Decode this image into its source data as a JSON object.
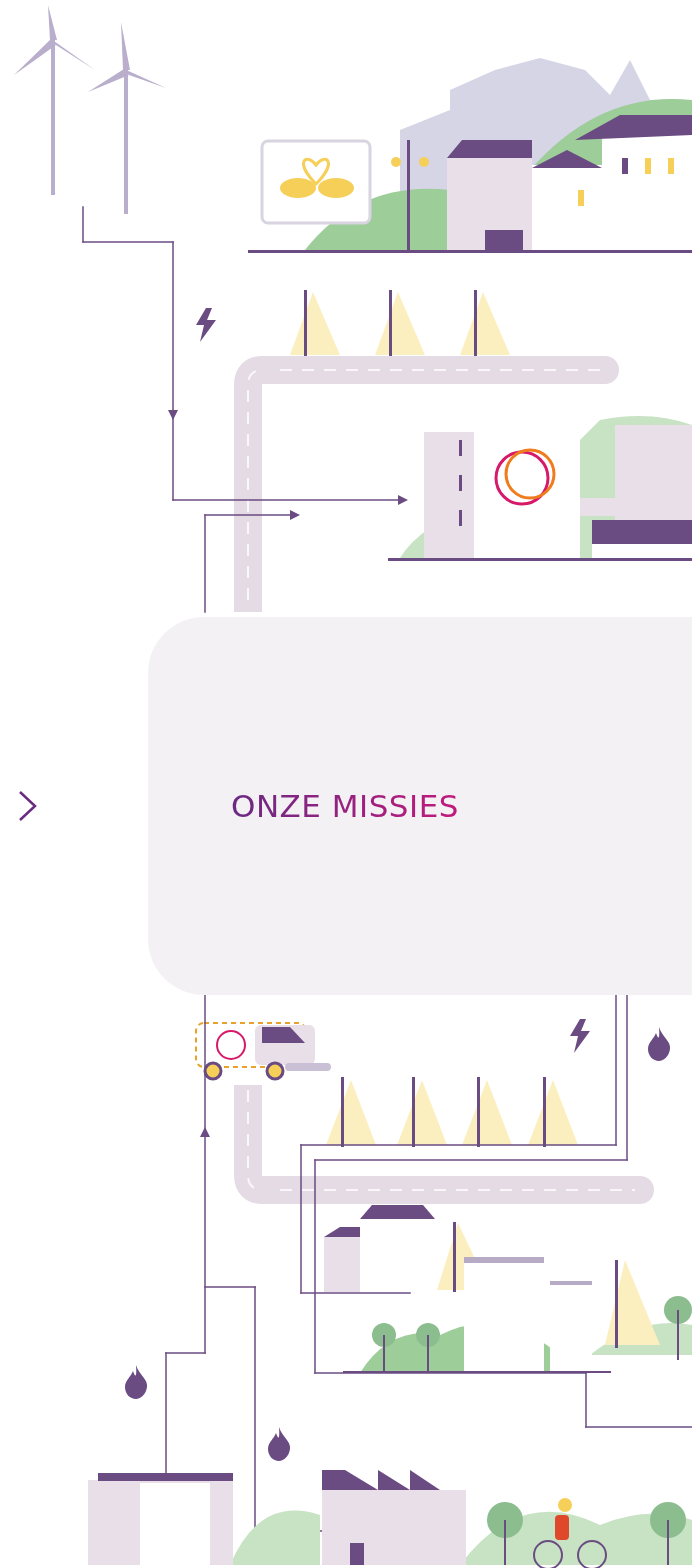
{
  "mission_card": {
    "title": "ONZE MISSIES"
  }
}
